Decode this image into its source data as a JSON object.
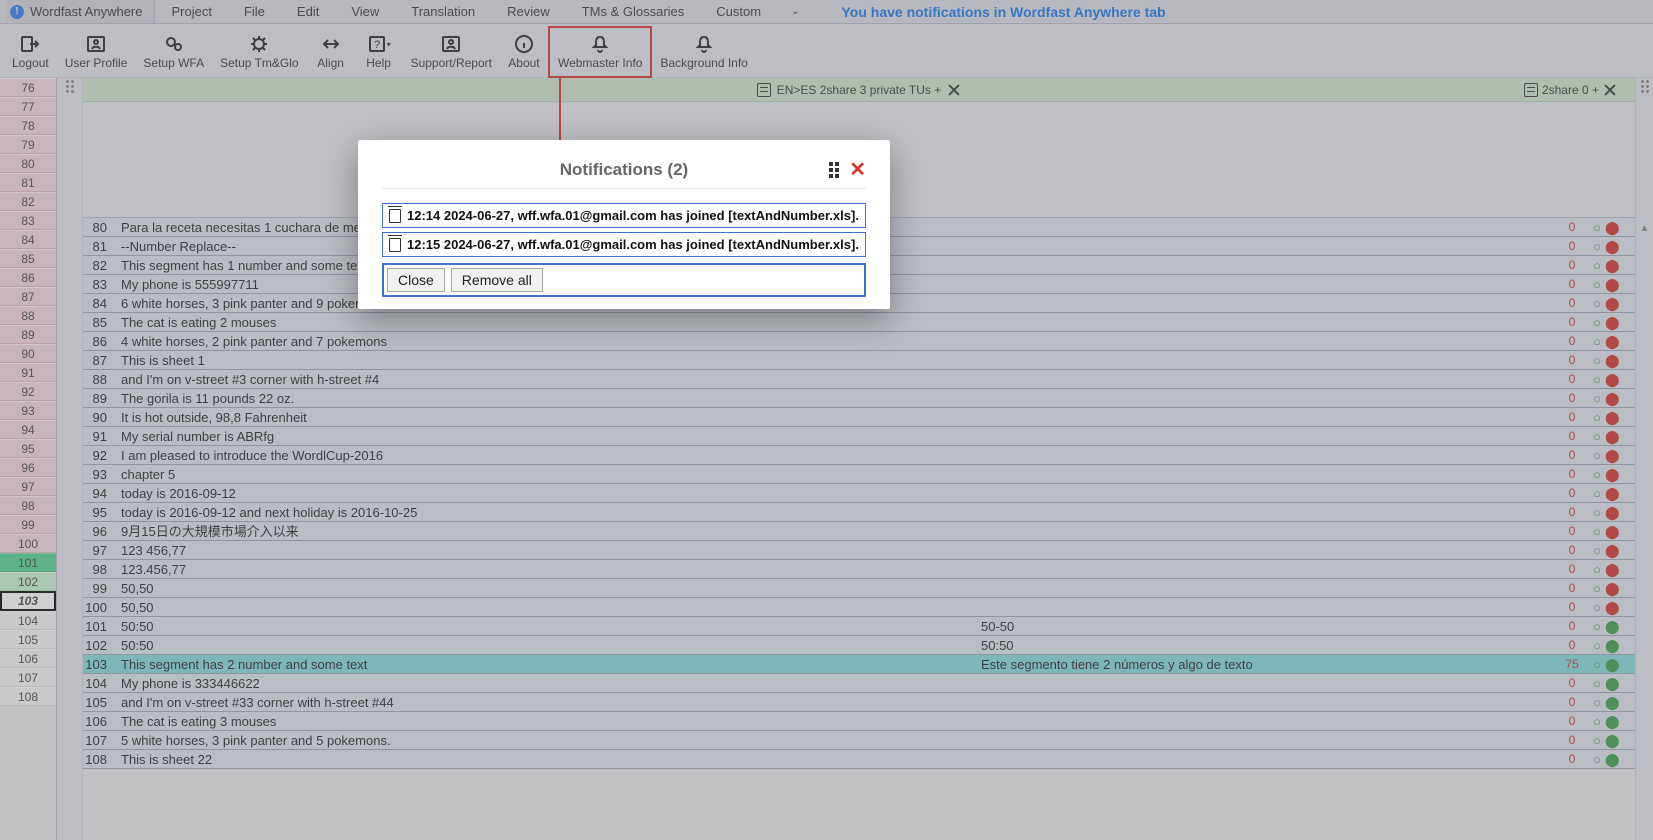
{
  "app": {
    "name": "Wordfast Anywhere"
  },
  "menu": {
    "items": [
      "Project",
      "File",
      "Edit",
      "View",
      "Translation",
      "Review",
      "TMs & Glossaries",
      "Custom"
    ],
    "notif_link": "You have notifications in Wordfast Anywhere tab"
  },
  "toolbar": {
    "logout": "Logout",
    "user_profile": "User Profile",
    "setup_wfa": "Setup WFA",
    "setup_tmglo": "Setup Tm&Glo",
    "align": "Align",
    "help": "Help",
    "support": "Support/Report",
    "about": "About",
    "webmaster": "Webmaster Info",
    "background": "Background Info"
  },
  "status": {
    "center": "EN>ES 2share 3 private TUs +",
    "right": "2share 0 +"
  },
  "left_gutter": {
    "start": 76,
    "end": 108
  },
  "segments": [
    {
      "idx": 80,
      "src": "Para la receta necesitas 1 cuchara de mesa",
      "score": "0",
      "user": "red"
    },
    {
      "idx": 81,
      "src": "--Number Replace--",
      "score": "0",
      "user": "red"
    },
    {
      "idx": 82,
      "src": "This segment has 1 number and some text",
      "score": "0",
      "user": "red"
    },
    {
      "idx": 83,
      "src": "My phone is 555997711",
      "score": "0",
      "user": "red"
    },
    {
      "idx": 84,
      "src": "6 white horses, 3 pink panter and 9 pokemons",
      "score": "0",
      "user": "red"
    },
    {
      "idx": 85,
      "src": "The cat is eating 2 mouses",
      "score": "0",
      "user": "red"
    },
    {
      "idx": 86,
      "src": "4 white horses, 2 pink panter and 7 pokemons",
      "score": "0",
      "user": "red"
    },
    {
      "idx": 87,
      "src": "This is sheet 1",
      "score": "0",
      "user": "red"
    },
    {
      "idx": 88,
      "src": "and I'm on v-street #3 corner with h-street #4",
      "score": "0",
      "user": "red"
    },
    {
      "idx": 89,
      "src": "The gorila is 11 pounds 22 oz.",
      "score": "0",
      "user": "red"
    },
    {
      "idx": 90,
      "src": "It is hot outside, 98,8 Fahrenheit",
      "score": "0",
      "user": "red"
    },
    {
      "idx": 91,
      "src": "My serial number is ABRfg",
      "score": "0",
      "user": "red"
    },
    {
      "idx": 92,
      "src": "I am pleased to introduce the WordlCup-2016",
      "score": "0",
      "user": "red"
    },
    {
      "idx": 93,
      "src": "chapter 5",
      "score": "0",
      "user": "red"
    },
    {
      "idx": 94,
      "src": "today is 2016-09-12",
      "score": "0",
      "user": "red"
    },
    {
      "idx": 95,
      "src": "today is 2016-09-12 and next holiday is 2016-10-25",
      "score": "0",
      "user": "red"
    },
    {
      "idx": 96,
      "src": "9月15日の大規模市場介入以来",
      "score": "0",
      "user": "red"
    },
    {
      "idx": 97,
      "src": "123 456,77",
      "score": "0",
      "user": "red"
    },
    {
      "idx": 98,
      "src": "123.456,77",
      "score": "0",
      "user": "red"
    },
    {
      "idx": 99,
      "src": "50,50",
      "score": "0",
      "user": "red"
    },
    {
      "idx": 100,
      "src": "50,50",
      "score": "0",
      "user": "red"
    },
    {
      "idx": 101,
      "src": "50:50",
      "tgt": "50-50",
      "score": "0",
      "user": "green"
    },
    {
      "idx": 102,
      "src": "50:50",
      "tgt": "50:50",
      "score": "0",
      "user": "green"
    },
    {
      "idx": 103,
      "src": "This segment has 2 number and some text",
      "tgt": "Este segmento tiene 2 números y algo de texto",
      "score": "75",
      "user": "green",
      "active": true
    },
    {
      "idx": 104,
      "src": "My phone is 333446622",
      "score": "0",
      "user": "green"
    },
    {
      "idx": 105,
      "src": "and I'm on v-street #33 corner with h-street #44",
      "score": "0",
      "user": "green"
    },
    {
      "idx": 106,
      "src": "The cat is eating 3 mouses",
      "score": "0",
      "user": "green"
    },
    {
      "idx": 107,
      "src": "5 white horses, 3 pink panter and 5 pokemons.",
      "score": "0",
      "user": "green"
    },
    {
      "idx": 108,
      "src": "This is sheet 22",
      "score": "0",
      "user": "green"
    }
  ],
  "modal": {
    "title": "Notifications (2)",
    "items": [
      "12:14 2024-06-27, wff.wfa.01@gmail.com has joined [textAndNumber.xls].",
      "12:15 2024-06-27, wff.wfa.01@gmail.com has joined [textAndNumber.xls]."
    ],
    "close": "Close",
    "remove_all": "Remove all"
  }
}
